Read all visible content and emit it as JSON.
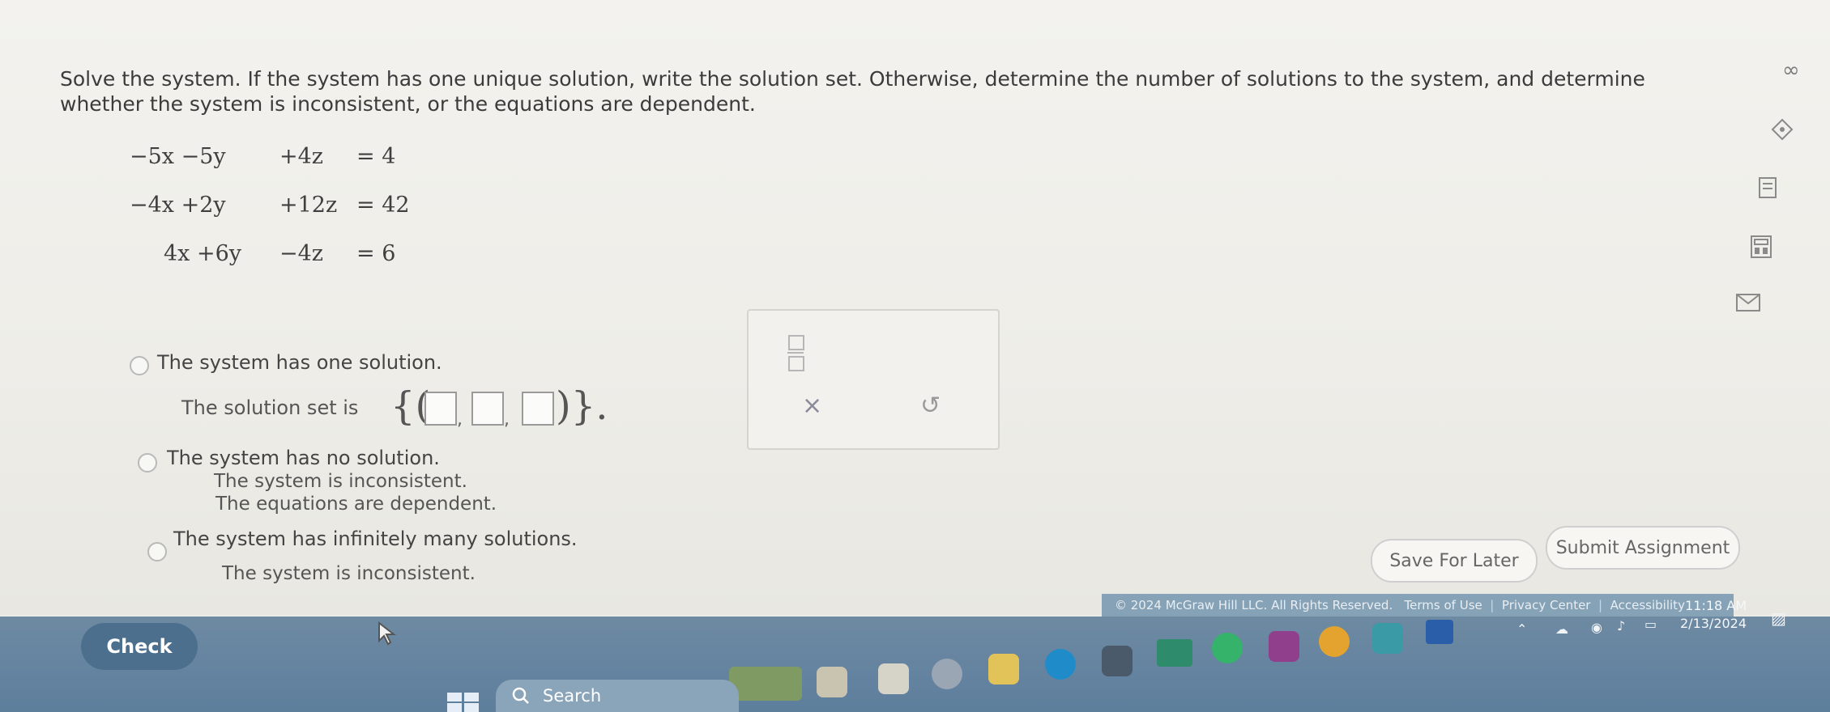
{
  "question": {
    "line1": "Solve the system. If the system has one unique solution, write the solution set. Otherwise, determine the number of solutions to the system, and determine",
    "line2": "whether the system is inconsistent, or the equations are dependent."
  },
  "equations": [
    {
      "xy": "−5x −5y",
      "z": "+4z",
      "rhs": "= 4"
    },
    {
      "xy": "−4x +2y",
      "z": "+12z",
      "rhs": "= 42"
    },
    {
      "xy": "4x +6y",
      "z": "−4z",
      "rhs": "= 6"
    }
  ],
  "options": {
    "one_solution": "The system has one solution.",
    "solution_set_label": "The solution set is",
    "set_open": "{(",
    "set_close": ")}.",
    "no_solution": "The system has no solution.",
    "inconsistent": "The system is inconsistent.",
    "dependent": "The equations are dependent.",
    "infinite": "The system has infinitely many solutions.",
    "infinite_inconsistent": "The system is inconsistent."
  },
  "tool_panel": {
    "clear_glyph": "×",
    "undo_glyph": "↺"
  },
  "side_icons": {
    "infinity": "∞"
  },
  "buttons": {
    "save_later": "Save For Later",
    "submit": "Submit Assignment",
    "check": "Check"
  },
  "footer": {
    "copyright": "© 2024 McGraw Hill LLC. All Rights Reserved.",
    "terms": "Terms of Use",
    "privacy": "Privacy Center",
    "accessibility": "Accessibility"
  },
  "taskbar": {
    "search_label": "Search",
    "time": "11:18 AM",
    "date": "2/13/2024"
  },
  "colors": {
    "check_button": "#4d6f8e",
    "taskbar": "#6483a0",
    "footer_bar": "#86a2b6"
  }
}
